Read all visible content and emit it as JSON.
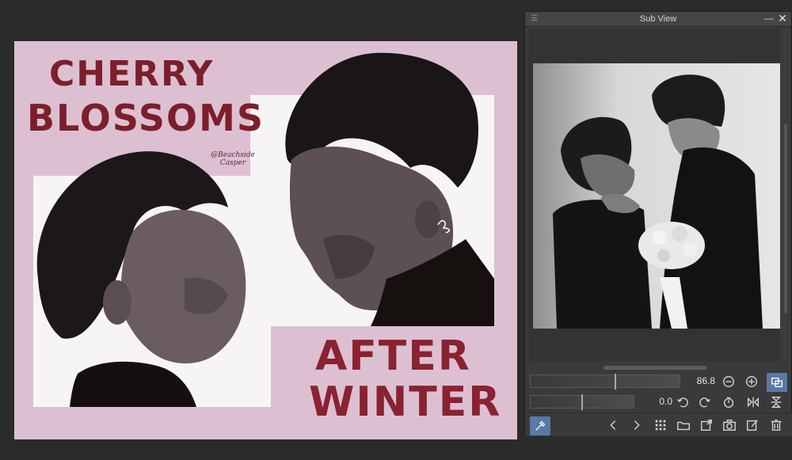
{
  "subview": {
    "title": "Sub View",
    "zoom_value": "86.8",
    "rotate_value": "0.0"
  },
  "artwork": {
    "title_line1": "CHERRY",
    "title_line2": "BLOSSOMS",
    "title_line3": "AFTER",
    "title_line4": "WINTER",
    "signature_line1": "@Beachside",
    "signature_line2": "Casper"
  },
  "colors": {
    "canvas_bg": "#dcc0d2",
    "title_color": "#7c1f2b",
    "accent_active": "#5a78a8",
    "app_bg": "#2b2b2b"
  },
  "icons": [
    "hamburger-icon",
    "minimize-icon",
    "close-icon",
    "zoom-out-icon",
    "zoom-in-icon",
    "fit-view-icon",
    "rotate-left-icon",
    "rotate-right-icon",
    "reset-rotation-icon",
    "flip-horizontal-icon",
    "flip-vertical-icon",
    "eyedropper-icon",
    "previous-icon",
    "next-icon",
    "grid-icon",
    "open-folder-icon",
    "import-icon",
    "camera-icon",
    "edit-icon",
    "trash-icon"
  ]
}
